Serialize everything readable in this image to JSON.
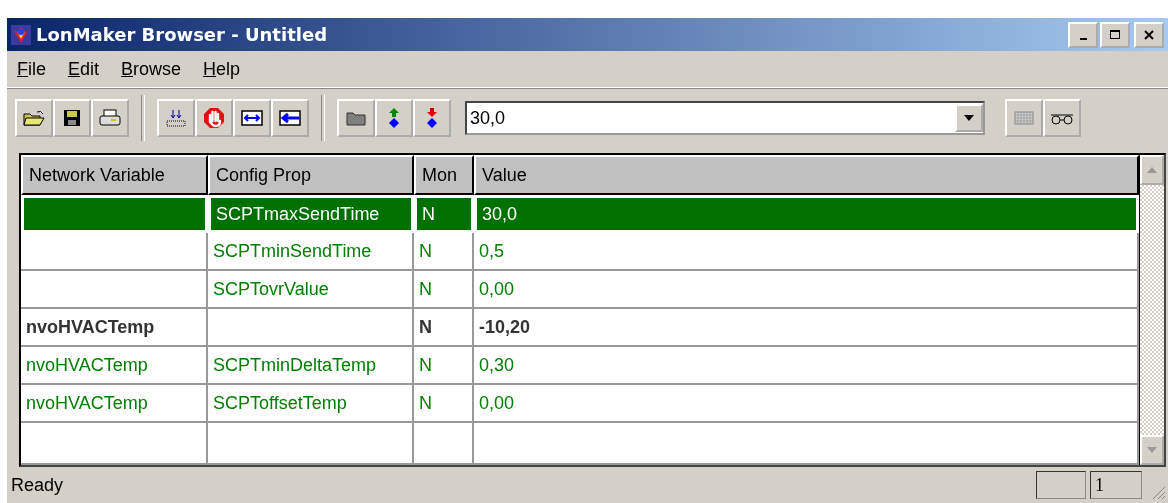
{
  "window": {
    "title": "LonMaker Browser - Untitled"
  },
  "menu": [
    {
      "label": "File"
    },
    {
      "label": "Edit"
    },
    {
      "label": "Browse"
    },
    {
      "label": "Help"
    }
  ],
  "toolbar": {
    "value_combo": {
      "value": "30,0"
    }
  },
  "table": {
    "columns": [
      "Network Variable",
      "Config Prop",
      "Mon",
      "Value"
    ],
    "rows": [
      {
        "kind": "property",
        "selected": true,
        "cells": [
          "",
          "SCPTmaxSendTime",
          "N",
          "30,0"
        ]
      },
      {
        "kind": "property",
        "selected": false,
        "cells": [
          "",
          "SCPTminSendTime",
          "N",
          "0,5"
        ]
      },
      {
        "kind": "property",
        "selected": false,
        "cells": [
          "",
          "SCPTovrValue",
          "N",
          "0,00"
        ]
      },
      {
        "kind": "variable",
        "selected": false,
        "cells": [
          "nvoHVACTemp",
          "",
          "N",
          "-10,20"
        ]
      },
      {
        "kind": "property",
        "selected": false,
        "cells": [
          "nvoHVACTemp",
          "SCPTminDeltaTemp",
          "N",
          "0,30"
        ]
      },
      {
        "kind": "property",
        "selected": false,
        "cells": [
          "nvoHVACTemp",
          "SCPToffsetTemp",
          "N",
          "0,00"
        ]
      }
    ]
  },
  "status_bar": {
    "text": "Ready",
    "panel": "1"
  }
}
